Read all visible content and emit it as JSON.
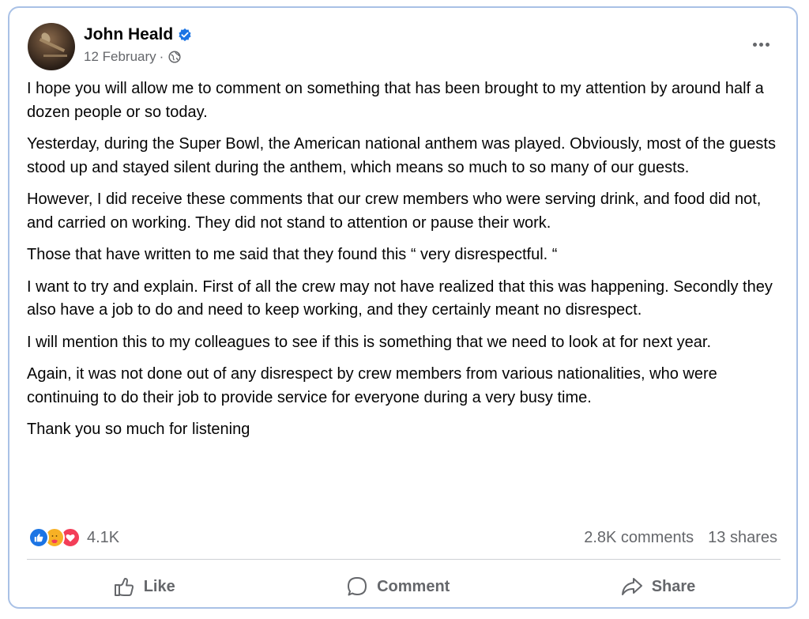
{
  "post": {
    "author": "John Heald",
    "date": "12 February",
    "separator": "·",
    "paragraphs": [
      "I hope you will allow me to comment on something that has been brought to my attention by around half a dozen people or so today.",
      "Yesterday, during the Super Bowl, the American national anthem was played. Obviously, most of the guests stood up and stayed silent during the anthem, which means so much to so many of our guests.",
      "However, I did receive these comments that our crew members who were serving drink, and food did not, and carried on working. They did not stand to attention or pause their work.",
      "Those that have written to me said that they found this “ very disrespectful. “",
      "I want to try and explain. First of all the crew may not have realized that this was happening. Secondly they also have a job to do and need to keep working, and they certainly meant no disrespect.",
      "I will mention this to my colleagues to see if this is something that we need to look at for next year.",
      "Again, it was not done out of any disrespect by crew members from various nationalities, who were continuing to do their job to provide service for everyone during a very busy time.",
      "Thank you so much for listening"
    ]
  },
  "reactions": {
    "count": "4.1K",
    "icons": [
      "like-icon",
      "care-icon",
      "love-icon"
    ]
  },
  "stats": {
    "comments": "2.8K comments",
    "shares": "13 shares"
  },
  "actions": {
    "like": "Like",
    "comment": "Comment",
    "share": "Share"
  },
  "colors": {
    "accent": "#1b74e4",
    "muted_text": "#65676b",
    "border": "#a9c1e6",
    "love": "#f33e58",
    "care": "#f7b125"
  }
}
